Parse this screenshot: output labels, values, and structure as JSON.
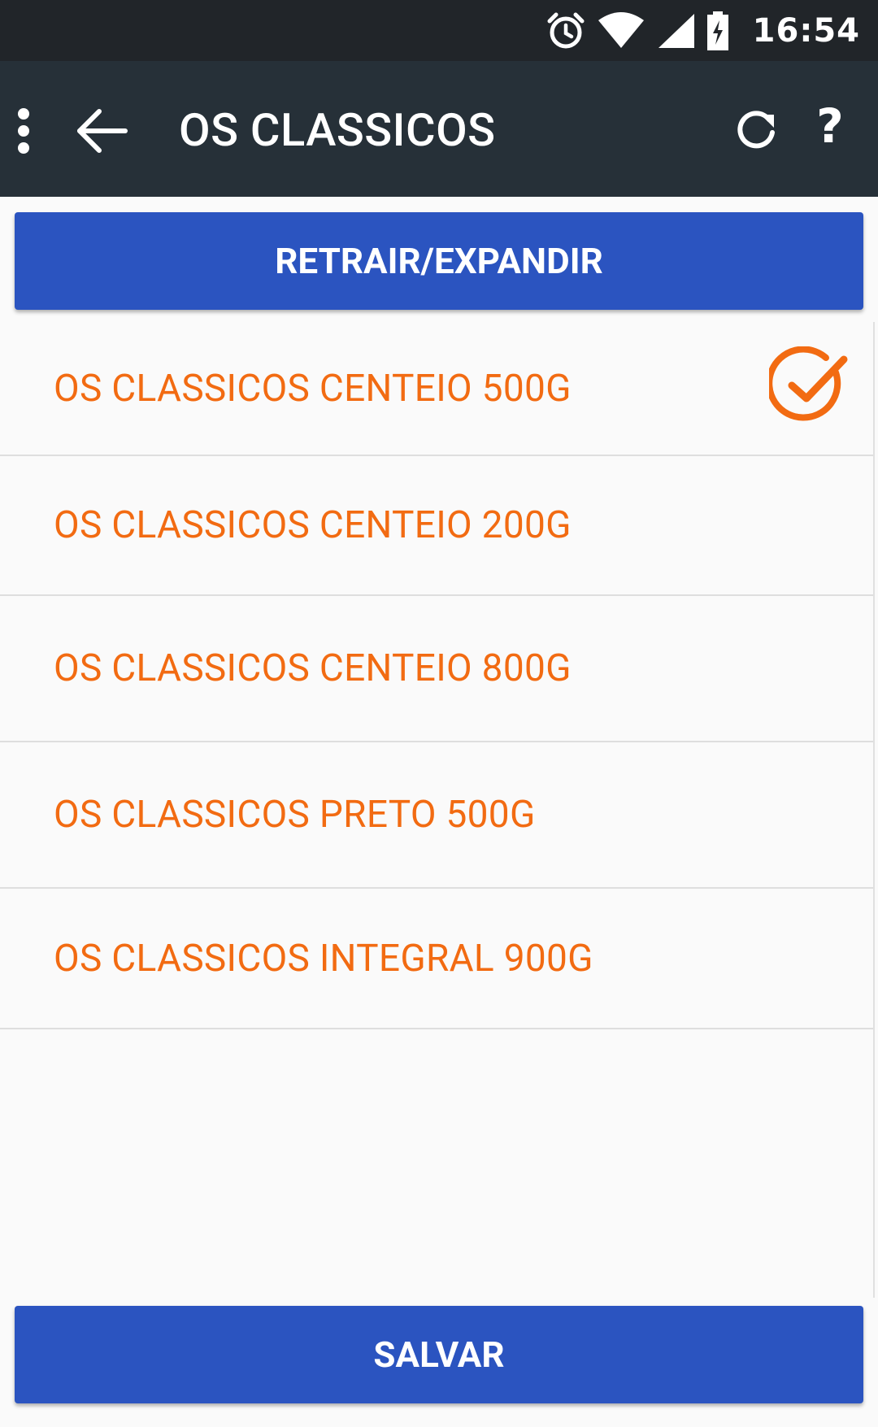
{
  "status_bar": {
    "time": "16:54",
    "icons": [
      "alarm-icon",
      "wifi-icon",
      "signal-icon",
      "battery-charging-icon"
    ]
  },
  "app_bar": {
    "title": "OS CLASSICOS",
    "overflow_icon": "more-vert-icon",
    "back_icon": "arrow-back-icon",
    "refresh_icon": "refresh-icon",
    "help_label": "?"
  },
  "toggle_button": {
    "label": "RETRAIR/EXPANDIR"
  },
  "products": [
    {
      "label": "OS CLASSICOS CENTEIO 500G",
      "selected": true
    },
    {
      "label": "OS CLASSICOS CENTEIO 200G",
      "selected": false
    },
    {
      "label": "OS CLASSICOS CENTEIO 800G",
      "selected": false
    },
    {
      "label": "OS CLASSICOS PRETO 500G",
      "selected": false
    },
    {
      "label": "OS CLASSICOS INTEGRAL 900G",
      "selected": false
    }
  ],
  "save_button": {
    "label": "SALVAR"
  },
  "colors": {
    "status_bar": "#212529",
    "app_bar": "#263038",
    "primary_button": "#2b54c0",
    "item_text": "#f26b12",
    "background": "#fafafa"
  }
}
